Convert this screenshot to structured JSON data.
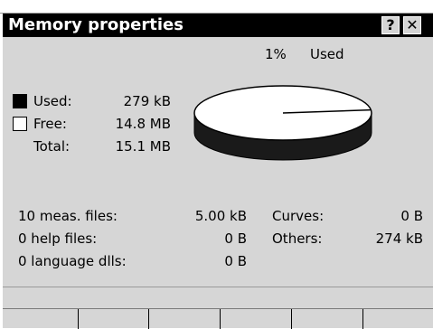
{
  "window": {
    "title": "Memory properties",
    "help_label": "?",
    "close_label": "✕"
  },
  "usage": {
    "percent_label": "1%",
    "used_caption": "Used",
    "used_fraction": 0.0182
  },
  "legend": {
    "used_label": "Used:",
    "used_value": "279 kB",
    "free_label": "Free:",
    "free_value": "14.8 MB",
    "total_label": "Total:",
    "total_value": "15.1 MB",
    "used_color": "#000000",
    "free_color": "#ffffff"
  },
  "details": {
    "meas_label": "10 meas. files:",
    "meas_value": "5.00 kB",
    "help_label": "0 help files:",
    "help_value": "0 B",
    "lang_label": "0 language dlls:",
    "lang_value": "0 B",
    "curves_label": "Curves:",
    "curves_value": "0 B",
    "others_label": "Others:",
    "others_value": "274 kB"
  },
  "buttons": [
    "",
    "",
    "",
    "",
    "",
    ""
  ]
}
